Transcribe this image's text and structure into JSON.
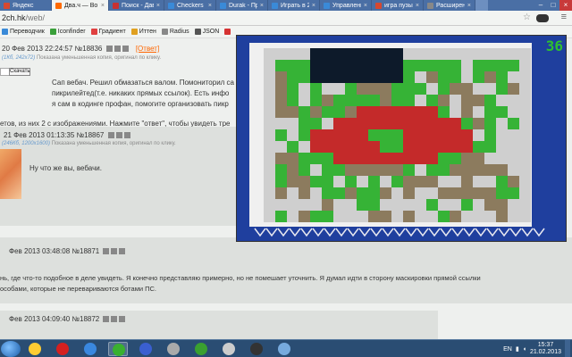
{
  "tabs": [
    {
      "label": "Яндекс",
      "color": "#d64830"
    },
    {
      "label": "Два.ч — Во",
      "color": "#ff6a00"
    },
    {
      "label": "Поиск - Дав",
      "color": "#c83232"
    },
    {
      "label": "Checkers",
      "color": "#3a8ad8"
    },
    {
      "label": "Durak - Пр",
      "color": "#3a8ad8"
    },
    {
      "label": "Играть в 2К",
      "color": "#3a8ad8"
    },
    {
      "label": "Управлени",
      "color": "#3a8ad8"
    },
    {
      "label": "игра пузыр",
      "color": "#d64830"
    },
    {
      "label": "Расширени",
      "color": "#888"
    }
  ],
  "address": {
    "host": "2ch.hk",
    "path": "/web/"
  },
  "bookmarks": [
    {
      "label": "Переводчик",
      "color": "#3a8ad8"
    },
    {
      "label": "Iconfinder",
      "color": "#3aa03a"
    },
    {
      "label": "Градиент",
      "color": "#e04040"
    },
    {
      "label": "Иттен",
      "color": "#e0a020"
    },
    {
      "label": "Radius",
      "color": "#888"
    },
    {
      "label": "JSON",
      "color": "#555"
    },
    {
      "label": "",
      "color": "#d63333"
    }
  ],
  "page": {
    "post1": {
      "date": "20 Фев 2013 22:24:57",
      "num": "№18836",
      "reply": "[Ответ]",
      "meta_file": "(1Кб, 242x72)",
      "meta_note": "Показана уменьшенная копия, оригинал по клику.",
      "download": "Скачать",
      "body": [
        "Сап вебач. Решил обмазаться валом. Помониторил са",
        "пикрилейтед(т.е. никаких прямых ссылок). Есть инфо",
        "я сам в кодинге профан, помогите организовать пикр"
      ]
    },
    "omitted": "етов, из них 2 с изображениями. Нажмите \"ответ\", чтобы увидеть тре",
    "post2": {
      "date": "21 Фев 2013 01:13:35",
      "num": "№18867",
      "meta_file": "(246Кб, 1200x1600)",
      "meta_note": "Показана уменьшенная копия, оригинал по клику.",
      "body": "Ну что же вы, вебачи."
    },
    "post3": {
      "date": "Фев 2013 03:48:08",
      "num": "№18871",
      "body": [
        "нь, где что-то подобное в деле увидеть. Я конечно представляю примерно, но не помешает уточнить. Я думал идти в сторону маскировки прямой ссылки",
        "особами, которые не перевариваются ботами ПС."
      ]
    },
    "post4": {
      "date": "Фев 2013 04:09:40",
      "num": "№18872"
    }
  },
  "game": {
    "score": "36",
    "board": [
      "WWWWDDDDDDDDWWWWWWWWWWW",
      "WGGGDDDDDDDDGGGGGWGGGGW",
      "WBGGDDDDDDDDGWBGGWGBGWW",
      "WBGWGWWGBBBGGGWGBBWWGBW",
      "WBGWGBGGGGBGGWGBWBBGWWW",
      "WBBGBGGBRRRRRRRGWBWGGWW",
      "WWWGGWRRRRRRRRRRRGBGWGW",
      "WGWGRRRRRGGGRRRRRRWGWWW",
      "WWGWRRRRRRGGRRRRRRGGWWW",
      "WBBGGGRRRRRRRRRGGBBWWWW",
      "WGBGWGGBBBBBGWGGBBBBBWW",
      "WGBBGGWGWGWGBBBWWBWWGBW",
      "WBWBWGGBGGBWBWWBBBBBGGW",
      "WWWWWBWWGGWWWWGWWGWBBWW",
      "WGWBGGWWWBBWBWWGBWWWBWW"
    ],
    "colors": {
      "W": "#cfcfcf",
      "G": "#36b336",
      "B": "#8c7b5e",
      "R": "#c42a2a",
      "D": "#0d1a2a"
    }
  },
  "taskbar": {
    "apps": [
      {
        "name": "explorer-app",
        "color": "#ffcc33"
      },
      {
        "name": "opera-app",
        "color": "#d42020"
      },
      {
        "name": "media-app",
        "color": "#3a88e0"
      },
      {
        "name": "chrome-app",
        "color": "#3ab030"
      },
      {
        "name": "photoshop-app",
        "color": "#3a5fd0"
      },
      {
        "name": "files-app",
        "color": "#aaaaaa"
      },
      {
        "name": "utorrent-app",
        "color": "#3aa030"
      },
      {
        "name": "app-8",
        "color": "#cccccc"
      },
      {
        "name": "app-9",
        "color": "#333333"
      },
      {
        "name": "app-10",
        "color": "#77aadd"
      }
    ],
    "lang": "EN",
    "time": "15:37",
    "date": "21.02.2013"
  }
}
